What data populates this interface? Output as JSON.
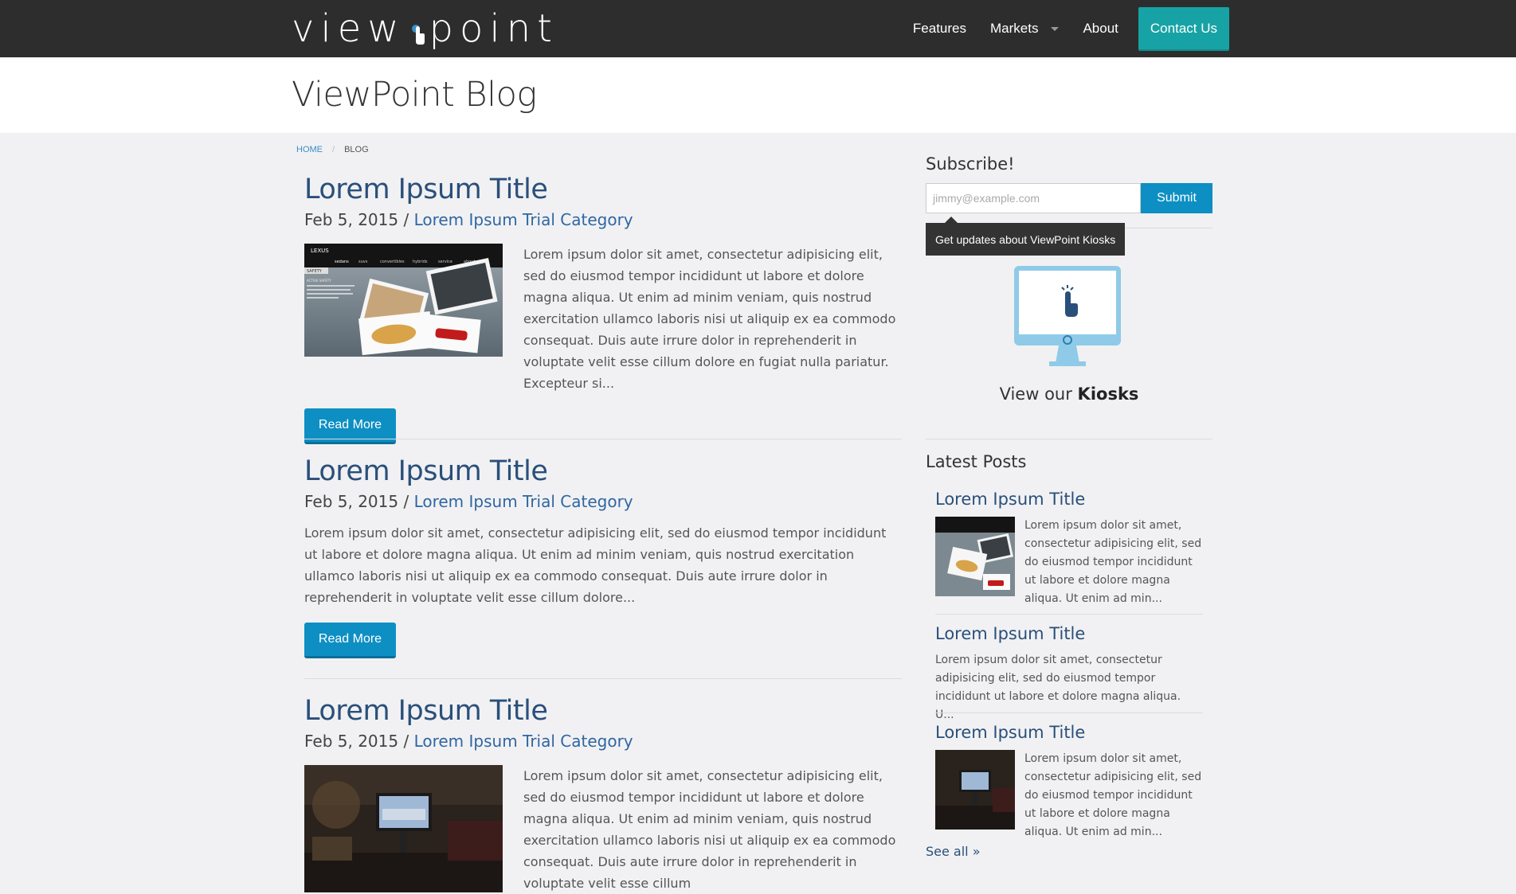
{
  "navbar": {
    "logo_left": "view",
    "logo_right": "point",
    "items": [
      {
        "label": "Features"
      },
      {
        "label": "Markets"
      },
      {
        "label": "About"
      }
    ],
    "contact_label": "Contact Us"
  },
  "header": {
    "title": "ViewPoint Blog"
  },
  "breadcrumb": {
    "home": "HOME",
    "sep": "/",
    "current": "BLOG"
  },
  "posts": [
    {
      "title": "Lorem Ipsum Title",
      "date": "Feb 5, 2015",
      "sep": " / ",
      "category": "Lorem Ipsum Trial Category",
      "excerpt": "Lorem ipsum dolor sit amet, consectetur adipisicing elit, sed do eiusmod tempor incididunt ut labore et dolore magna aliqua. Ut enim ad minim veniam, quis nostrud exercitation ullamco laboris nisi ut aliquip ex ea commodo consequat. Duis aute irrure dolor in reprehenderit in voluptate velit esse cillum dolore en fugiat nulla pariatur. Excepteur si...",
      "button": "Read More"
    },
    {
      "title": "Lorem Ipsum Title",
      "date": "Feb 5, 2015",
      "sep": " / ",
      "category": "Lorem Ipsum Trial Category",
      "excerpt": "Lorem ipsum dolor sit amet, consectetur adipisicing elit, sed do eiusmod tempor incididunt ut labore et dolore magna aliqua. Ut enim ad minim veniam, quis nostrud exercitation ullamco laboris nisi ut aliquip ex ea commodo consequat. Duis aute irrure dolor in reprehenderit in voluptate velit esse cillum dolore...",
      "button": "Read More"
    },
    {
      "title": "Lorem Ipsum Title",
      "date": "Feb 5, 2015",
      "sep": " / ",
      "category": "Lorem Ipsum Trial Category",
      "excerpt": "Lorem ipsum dolor sit amet, consectetur adipisicing elit, sed do eiusmod tempor incididunt ut labore et dolore magna aliqua. Ut enim ad minim veniam, quis nostrud exercitation ullamco laboris nisi ut aliquip ex ea commodo consequat. Duis aute irrure dolor in reprehenderit in voluptate velit esse cillum"
    }
  ],
  "sidebar": {
    "subscribe_heading": "Subscribe!",
    "email_placeholder": "jimmy@example.com",
    "submit_label": "Submit",
    "tooltip": "Get updates about ViewPoint Kiosks",
    "kiosk_prefix": "View our ",
    "kiosk_bold": "Kiosks",
    "latest_heading": "Latest Posts",
    "latest": [
      {
        "title": "Lorem Ipsum Title",
        "text": "Lorem ipsum dolor sit amet, consectetur adipisicing elit, sed do eiusmod tempor incididunt ut labore et dolore magna aliqua. Ut enim ad min..."
      },
      {
        "title": "Lorem Ipsum Title",
        "text": "Lorem ipsum dolor sit amet, consectetur adipisicing elit, sed do eiusmod tempor incididunt ut labore et dolore magna aliqua. U..."
      },
      {
        "title": "Lorem Ipsum Title",
        "text": "Lorem ipsum dolor sit amet, consectetur adipisicing elit, sed do eiusmod tempor incididunt ut labore et dolore magna aliqua. Ut enim ad min..."
      }
    ],
    "see_all": "See all »"
  },
  "thumb_text": {
    "brand": "LEXUS",
    "nav": [
      "sedans",
      "suvs",
      "convertibles",
      "hybrids",
      "service",
      "about"
    ],
    "badge": "SAFETY",
    "heading": "ACTIVE SAFETY"
  },
  "colors": {
    "navbar_bg": "#2d2d2d",
    "contact_bg": "#17a3a5",
    "button_bg": "#0d8fc3",
    "title_blue": "#2a4f7a",
    "kiosk_blue": "#8fcbe8"
  }
}
